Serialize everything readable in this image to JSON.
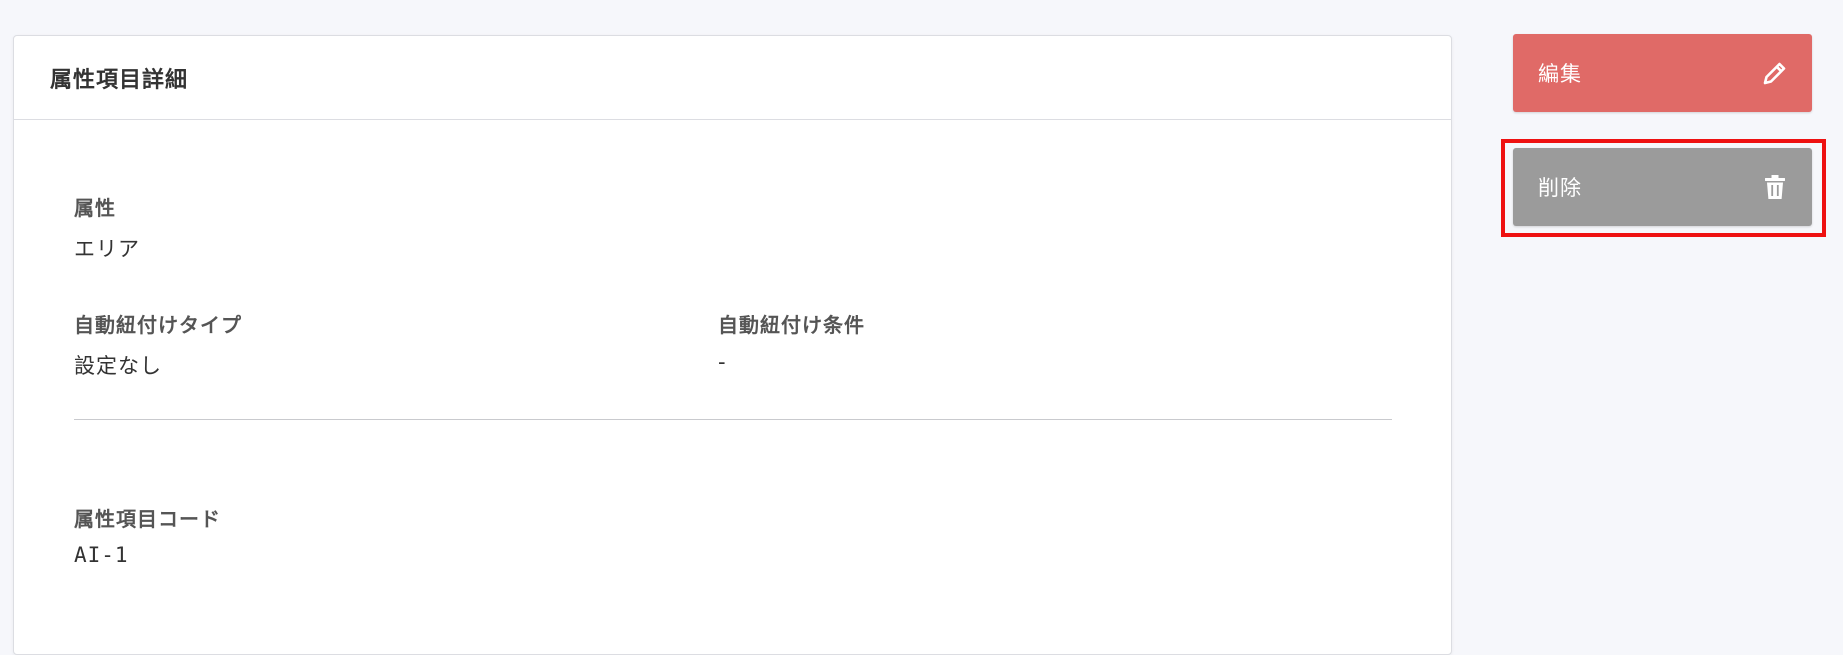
{
  "card": {
    "title": "属性項目詳細"
  },
  "fields": {
    "attribute": {
      "label": "属性",
      "value": "エリア"
    },
    "auto_link_type": {
      "label": "自動紐付けタイプ",
      "value": "設定なし"
    },
    "auto_link_condition": {
      "label": "自動紐付け条件",
      "value": "-"
    },
    "attribute_item_code": {
      "label": "属性項目コード",
      "value": "AI-1"
    }
  },
  "actions": {
    "edit_label": "編集",
    "edit_icon": "pencil-icon",
    "edit_color": "#e06a67",
    "delete_label": "削除",
    "delete_icon": "trash-icon",
    "delete_color": "#9b9b9b",
    "highlight_color": "#ee1111"
  }
}
